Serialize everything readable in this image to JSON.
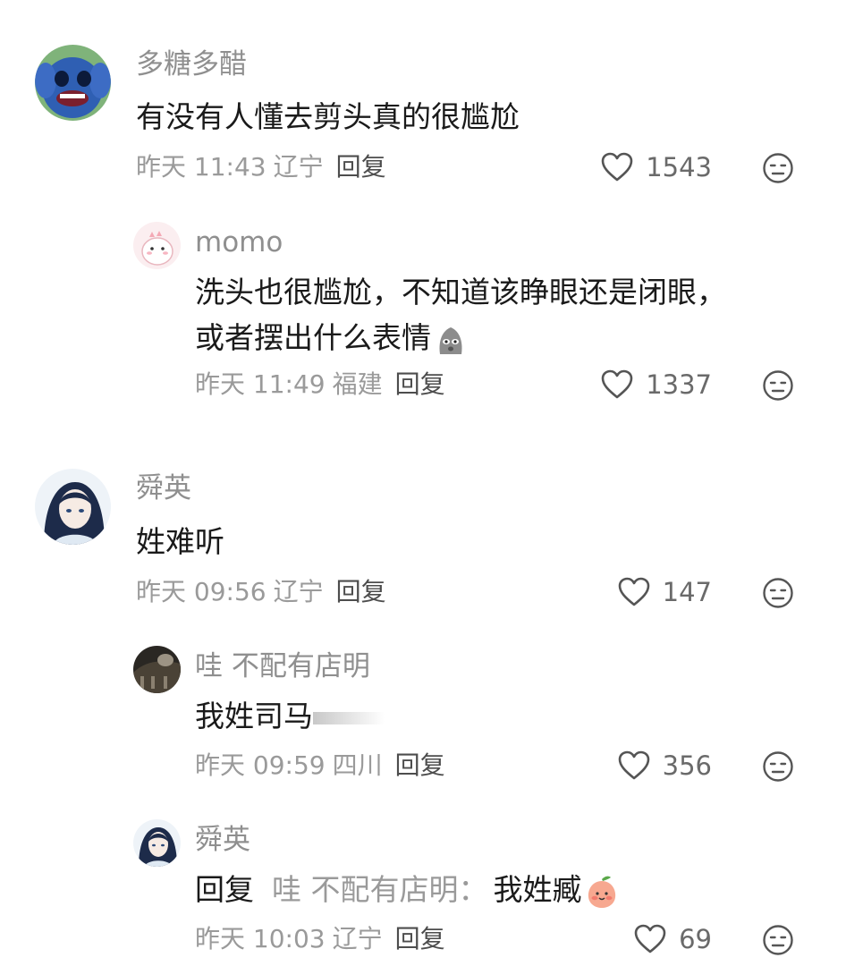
{
  "comments": [
    {
      "user": "多糖多醋",
      "text": "有没有人懂去剪头真的很尴尬",
      "time": "昨天 11:43",
      "region": "辽宁",
      "reply_label": "回复",
      "likes": "1543",
      "avatar": "stitch-avatar"
    },
    {
      "user": "momo",
      "text_line1": "洗头也很尴尬，不知道该睁眼还是闭眼，",
      "text_line2": "或者摆出什么表情",
      "time": "昨天 11:49",
      "region": "福建",
      "reply_label": "回复",
      "likes": "1337",
      "emoji": "moai-emoji",
      "avatar": "pink-dino-avatar"
    },
    {
      "user": "舜英",
      "text": "姓难听",
      "time": "昨天 09:56",
      "region": "辽宁",
      "reply_label": "回复",
      "likes": "147",
      "avatar": "anime-girl-avatar"
    },
    {
      "user": "哇 不配有店明",
      "text": "我姓司马",
      "time": "昨天 09:59",
      "region": "四川",
      "reply_label": "回复",
      "likes": "356",
      "avatar": "dark-photo-avatar"
    },
    {
      "user": "舜英",
      "reply_prefix": "回复",
      "reply_to": "哇 不配有店明：",
      "text": "我姓臧",
      "time": "昨天 10:03",
      "region": "辽宁",
      "reply_label": "回复",
      "likes": "69",
      "emoji": "peach-emoji",
      "avatar": "anime-girl-avatar"
    }
  ],
  "colors": {
    "username": "#8f8f8f",
    "text": "#1a1a1a",
    "meta": "#9a9a9a",
    "reply": "#4d4d4d"
  }
}
